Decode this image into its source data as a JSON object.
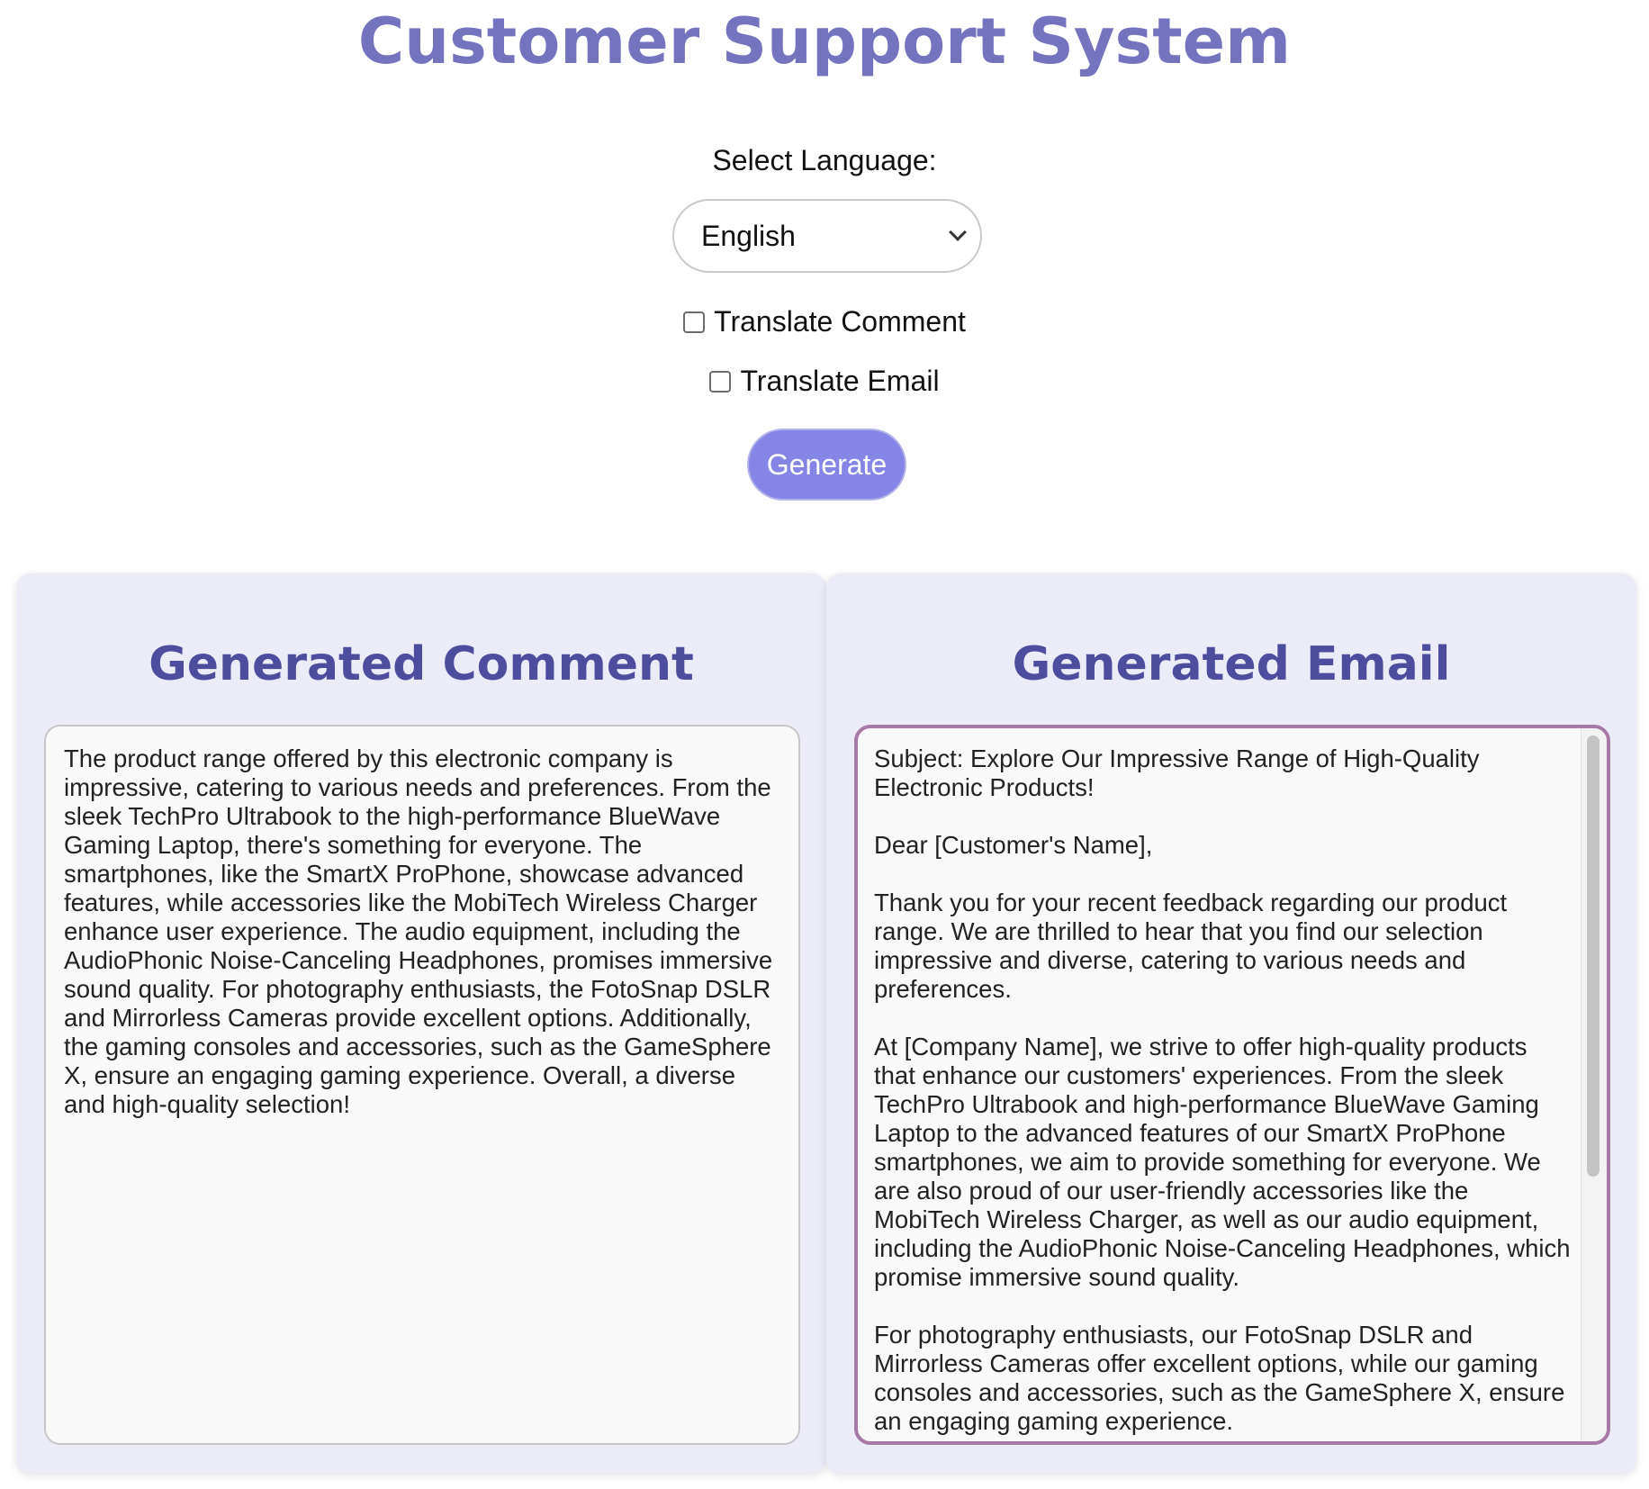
{
  "header": {
    "title": "Customer Support System"
  },
  "language": {
    "label": "Select Language:",
    "selected": "English"
  },
  "options": {
    "translate_comment": {
      "label": "Translate Comment",
      "checked": false
    },
    "translate_email": {
      "label": "Translate Email",
      "checked": false
    }
  },
  "actions": {
    "generate_label": "Generate"
  },
  "comment_panel": {
    "title": "Generated Comment",
    "text": "The product range offered by this electronic company is impressive, catering to various needs and preferences. From the sleek TechPro Ultrabook to the high-performance BlueWave Gaming Laptop, there's something for everyone. The smartphones, like the SmartX ProPhone, showcase advanced features, while accessories like the MobiTech Wireless Charger enhance user experience. The audio equipment, including the AudioPhonic Noise-Canceling Headphones, promises immersive sound quality. For photography enthusiasts, the FotoSnap DSLR and Mirrorless Cameras provide excellent options. Additionally, the gaming consoles and accessories, such as the GameSphere X, ensure an engaging gaming experience. Overall, a diverse and high-quality selection!"
  },
  "email_panel": {
    "title": "Generated Email",
    "paragraphs": [
      "Subject: Explore Our Impressive Range of High-Quality Electronic Products!",
      "Dear [Customer's Name],",
      "Thank you for your recent feedback regarding our product range. We are thrilled to hear that you find our selection impressive and diverse, catering to various needs and preferences.",
      "At [Company Name], we strive to offer high-quality products that enhance our customers' experiences. From the sleek TechPro Ultrabook and high-performance BlueWave Gaming Laptop to the advanced features of our SmartX ProPhone smartphones, we aim to provide something for everyone. We are also proud of our user-friendly accessories like the MobiTech Wireless Charger, as well as our audio equipment, including the AudioPhonic Noise-Canceling Headphones, which promise immersive sound quality.",
      "For photography enthusiasts, our FotoSnap DSLR and Mirrorless Cameras offer excellent options, while our gaming consoles and accessories, such as the GameSphere X, ensure an engaging gaming experience."
    ]
  },
  "colors": {
    "title": "#7474be",
    "panel_title": "#4d4d9e",
    "panel_bg": "#ececf8",
    "button_bg": "#8585e6",
    "focus_border": "#a679a6"
  }
}
